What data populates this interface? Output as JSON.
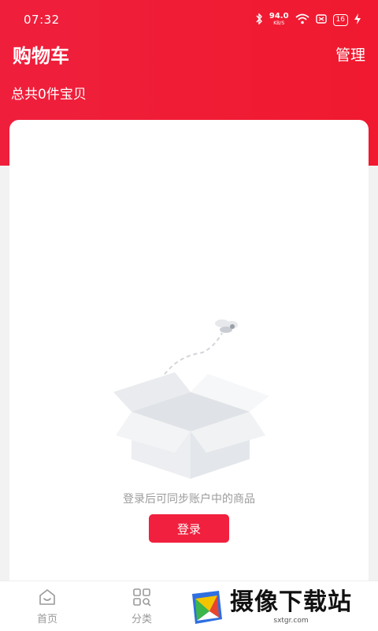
{
  "status_bar": {
    "time": "07:32",
    "net_speed": "94.0",
    "net_unit": "KB/S",
    "battery": "16"
  },
  "header": {
    "title": "购物车",
    "manage_label": "管理",
    "count_text": "总共0件宝贝"
  },
  "empty_state": {
    "message": "登录后可同步账户中的商品",
    "login_label": "登录"
  },
  "tabbar": {
    "items": [
      {
        "label": "首页",
        "icon": "home-icon"
      },
      {
        "label": "分类",
        "icon": "category-icon"
      }
    ]
  },
  "watermark": {
    "text": "摄像下载站",
    "url": "sxtgr.com"
  },
  "colors": {
    "brand_red": "#f0203e",
    "text_gray": "#9b9b9b"
  }
}
